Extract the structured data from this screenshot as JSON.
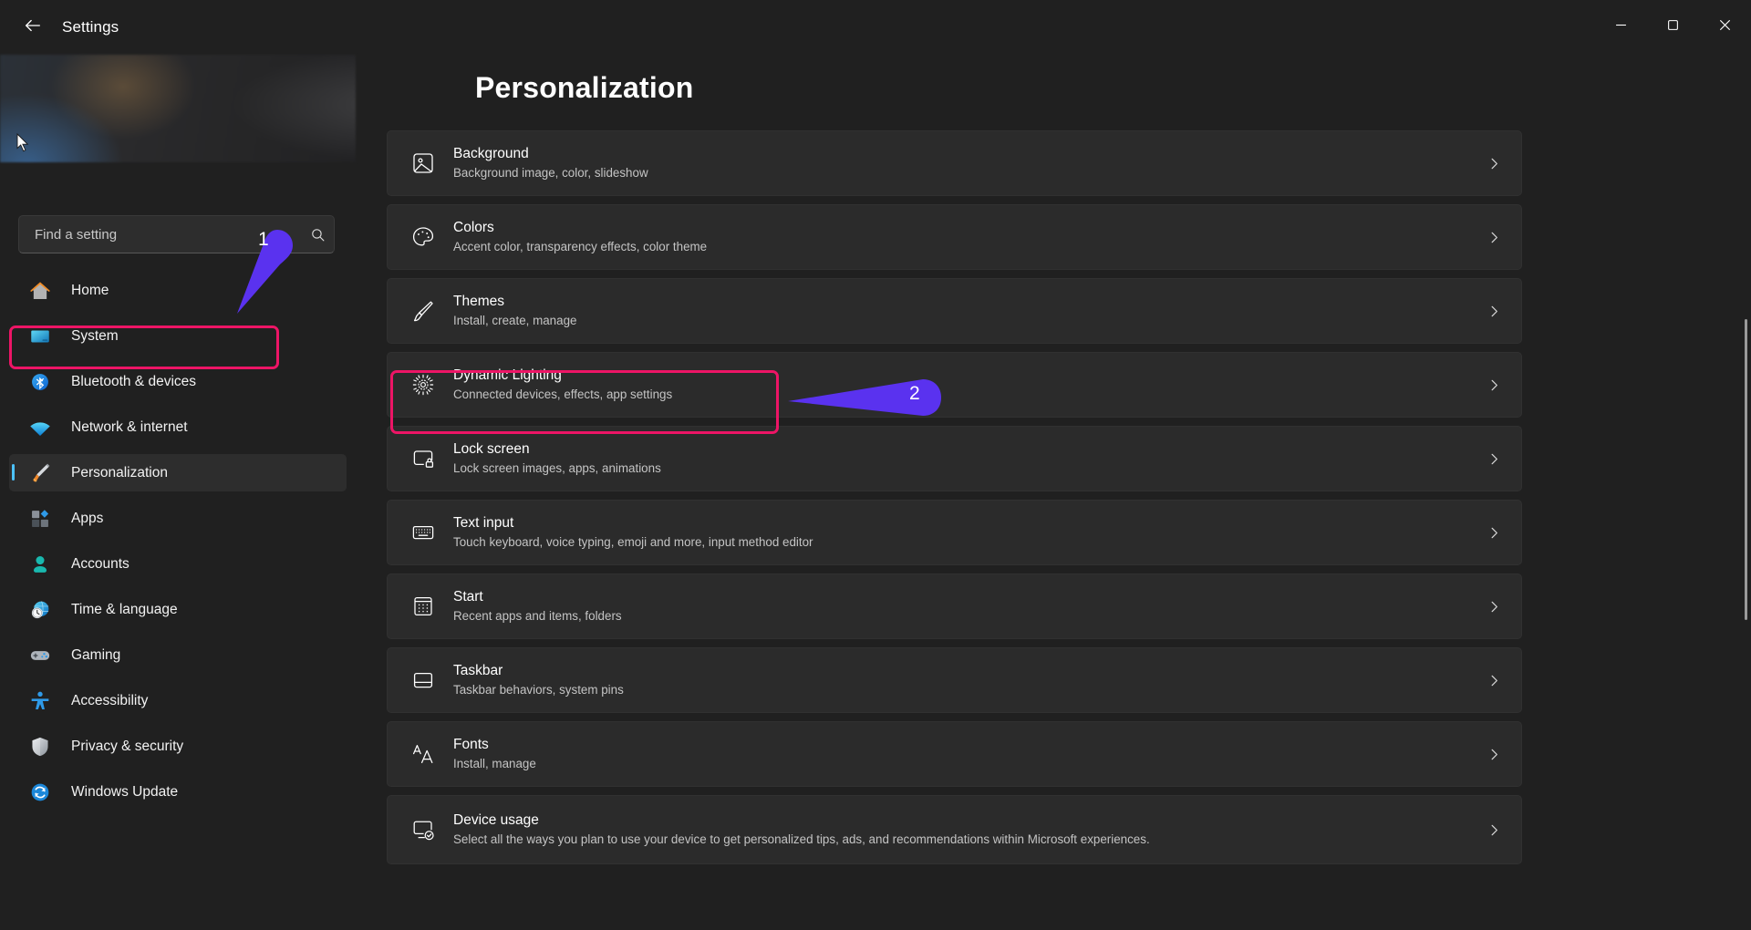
{
  "window": {
    "title": "Settings",
    "back_icon": "back-arrow-icon",
    "controls": {
      "minimize": "minimize-icon",
      "maximize": "maximize-icon",
      "close": "close-icon"
    }
  },
  "sidebar": {
    "search": {
      "placeholder": "Find a setting",
      "value": "",
      "icon": "search-icon"
    },
    "items": [
      {
        "label": "Home",
        "icon": "home-icon",
        "selected": false
      },
      {
        "label": "System",
        "icon": "system-icon",
        "selected": false
      },
      {
        "label": "Bluetooth & devices",
        "icon": "bluetooth-icon",
        "selected": false
      },
      {
        "label": "Network & internet",
        "icon": "network-icon",
        "selected": false
      },
      {
        "label": "Personalization",
        "icon": "personalization-icon",
        "selected": true
      },
      {
        "label": "Apps",
        "icon": "apps-icon",
        "selected": false
      },
      {
        "label": "Accounts",
        "icon": "accounts-icon",
        "selected": false
      },
      {
        "label": "Time & language",
        "icon": "time-language-icon",
        "selected": false
      },
      {
        "label": "Gaming",
        "icon": "gaming-icon",
        "selected": false
      },
      {
        "label": "Accessibility",
        "icon": "accessibility-icon",
        "selected": false
      },
      {
        "label": "Privacy & security",
        "icon": "privacy-security-icon",
        "selected": false
      },
      {
        "label": "Windows Update",
        "icon": "windows-update-icon",
        "selected": false
      }
    ]
  },
  "main": {
    "page_title": "Personalization",
    "cards": [
      {
        "title": "Background",
        "subtitle": "Background image, color, slideshow",
        "icon": "image-icon"
      },
      {
        "title": "Colors",
        "subtitle": "Accent color, transparency effects, color theme",
        "icon": "palette-icon"
      },
      {
        "title": "Themes",
        "subtitle": "Install, create, manage",
        "icon": "brush-icon"
      },
      {
        "title": "Dynamic Lighting",
        "subtitle": "Connected devices, effects, app settings",
        "icon": "lighting-icon"
      },
      {
        "title": "Lock screen",
        "subtitle": "Lock screen images, apps, animations",
        "icon": "lock-screen-icon"
      },
      {
        "title": "Text input",
        "subtitle": "Touch keyboard, voice typing, emoji and more, input method editor",
        "icon": "keyboard-icon"
      },
      {
        "title": "Start",
        "subtitle": "Recent apps and items, folders",
        "icon": "start-icon"
      },
      {
        "title": "Taskbar",
        "subtitle": "Taskbar behaviors, system pins",
        "icon": "taskbar-icon"
      },
      {
        "title": "Fonts",
        "subtitle": "Install, manage",
        "icon": "fonts-icon"
      },
      {
        "title": "Device usage",
        "subtitle": "Select all the ways you plan to use your device to get personalized tips, ads, and recommendations within Microsoft experiences.",
        "icon": "device-usage-icon"
      }
    ]
  },
  "annotations": {
    "accent_color": "#5a32ef",
    "highlight_color": "#ed1566",
    "markers": [
      {
        "number": "1",
        "target": "Personalization"
      },
      {
        "number": "2",
        "target": "Lock screen"
      }
    ]
  }
}
